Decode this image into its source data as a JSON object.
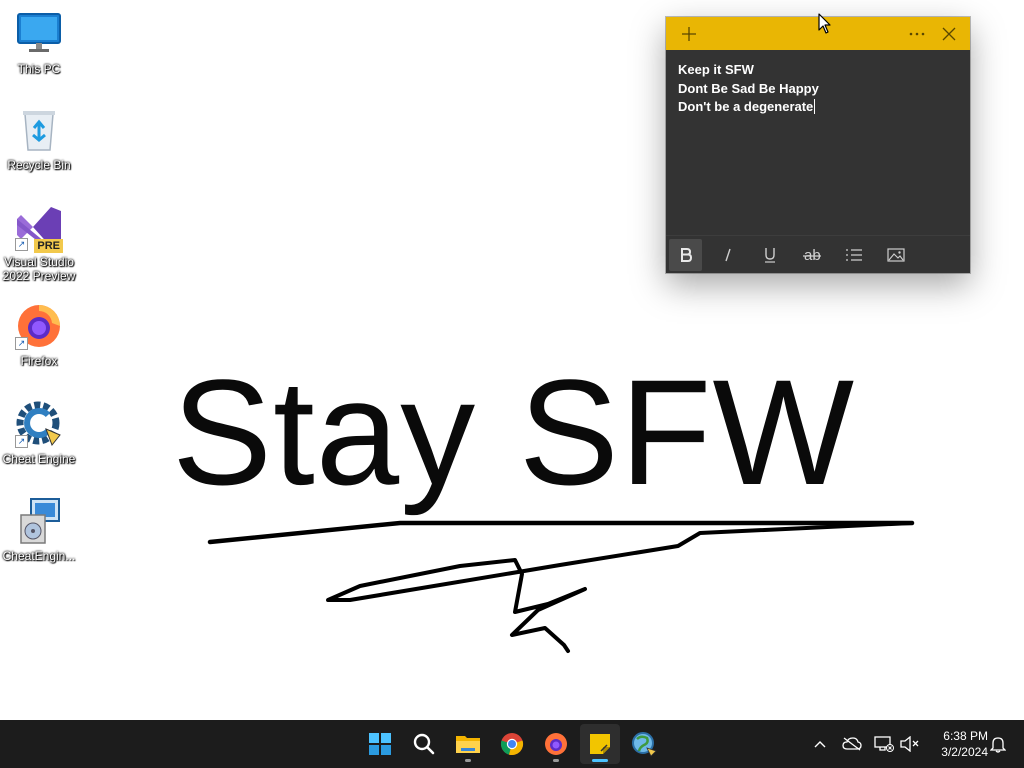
{
  "desktop": {
    "icons": [
      {
        "label": "This PC",
        "icon": "monitor-icon"
      },
      {
        "label": "Recycle Bin",
        "icon": "recycle-bin-icon"
      },
      {
        "label": "Visual Studio 2022 Preview",
        "icon": "visual-studio-preview-icon",
        "badge": "PRE"
      },
      {
        "label": "Firefox",
        "icon": "firefox-icon"
      },
      {
        "label": "Cheat Engine",
        "icon": "cheat-engine-icon"
      },
      {
        "label": "CheatEngin...",
        "icon": "installer-icon"
      }
    ],
    "wallpaper_text": "Stay SFW"
  },
  "sticky_note": {
    "header_color": "#e9b604",
    "body_color": "#333333",
    "lines": [
      "Keep it SFW",
      "Dont Be Sad Be Happy",
      "Don't be a degenerate"
    ],
    "toolbar": [
      "bold-icon",
      "italic-icon",
      "underline-icon",
      "strikethrough-icon",
      "bullet-list-icon",
      "image-icon"
    ]
  },
  "taskbar": {
    "apps": [
      "start-icon",
      "search-icon",
      "file-explorer-icon",
      "chrome-icon",
      "firefox-icon",
      "sticky-notes-icon",
      "cheat-engine-icon"
    ],
    "active_app": "sticky-notes-icon",
    "time": "6:38 PM",
    "date": "3/2/2024",
    "accent": "#4cc2ff"
  }
}
